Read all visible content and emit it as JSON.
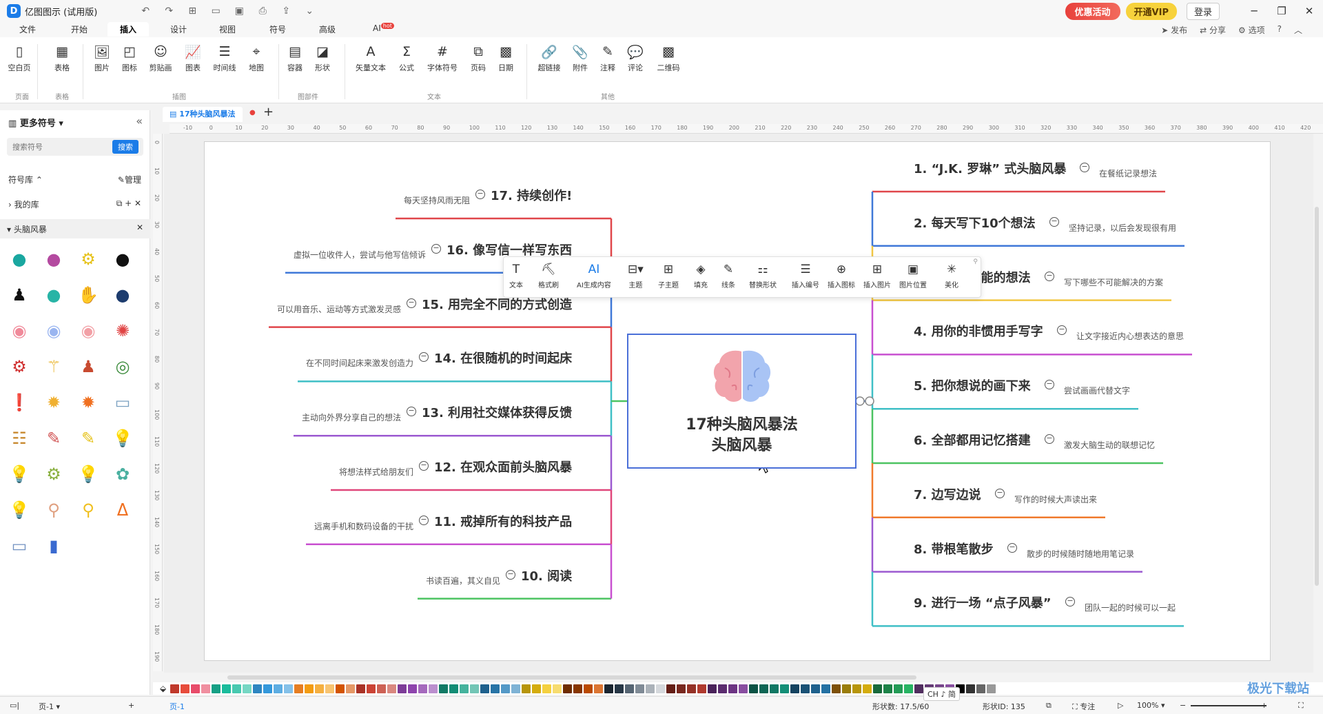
{
  "app": {
    "title": "亿图图示 (试用版)",
    "logo": "D"
  },
  "titlebar": {
    "promo": "优惠活动",
    "vip": "开通VIP",
    "login": "登录"
  },
  "menu": {
    "tabs": [
      "文件",
      "开始",
      "插入",
      "设计",
      "视图",
      "符号",
      "高级",
      "AI"
    ],
    "active": "插入",
    "ai_badge": "hot",
    "right": [
      "发布",
      "分享",
      "选项"
    ]
  },
  "ribbon": {
    "buttons": [
      "空白页",
      "表格",
      "图片",
      "图标",
      "剪贴画",
      "图表",
      "时间线",
      "地图",
      "容器",
      "形状",
      "矢量文本",
      "公式",
      "字体符号",
      "页码",
      "日期",
      "超链接",
      "附件",
      "注释",
      "评论",
      "二维码"
    ],
    "groups": [
      "页面",
      "表格",
      "插图",
      "图部件",
      "文本",
      "其他"
    ]
  },
  "leftpanel": {
    "title": "更多符号",
    "search_placeholder": "搜索符号",
    "search_button": "搜索",
    "library_label": "符号库",
    "manage": "管理",
    "my_library": "我的库",
    "category": "头脑风暴"
  },
  "doc": {
    "tab_title": "17种头脑风暴法",
    "new_tab": "+"
  },
  "ruler_h": [
    "-10",
    "0",
    "10",
    "20",
    "30",
    "40",
    "50",
    "60",
    "70",
    "80",
    "90",
    "100",
    "110",
    "120",
    "130",
    "140",
    "150",
    "160",
    "170",
    "180",
    "190",
    "200",
    "210",
    "220",
    "230",
    "240",
    "250",
    "260",
    "270",
    "280",
    "290",
    "300",
    "310",
    "320",
    "330",
    "340",
    "350",
    "360",
    "370",
    "380",
    "390",
    "400",
    "410",
    "420"
  ],
  "ruler_v": [
    "0",
    "10",
    "20",
    "30",
    "40",
    "50",
    "60",
    "70",
    "80",
    "90",
    "100",
    "110",
    "120",
    "130",
    "140",
    "150",
    "160",
    "170",
    "180",
    "190"
  ],
  "mindmap": {
    "center": {
      "line1": "17种头脑风暴法",
      "line2": "头脑风暴"
    },
    "right": [
      {
        "title": "1. “J.K. 罗琳” 式头脑风暴",
        "note": "在餐纸记录想法",
        "color": "#e0464a"
      },
      {
        "title": "2. 每天写下10个想法",
        "note": "坚持记录，以后会发现很有用",
        "color": "#3f78d8"
      },
      {
        "title": "3. 每个不可能的想法",
        "note": "写下哪些不可能解决的方案",
        "color": "#f2c744"
      },
      {
        "title": "4. 用你的非惯用手写字",
        "note": "让文字接近内心想表达的意思",
        "color": "#c84fd0"
      },
      {
        "title": "5. 把你想说的画下来",
        "note": "尝试画画代替文字",
        "color": "#3fbfc6"
      },
      {
        "title": "6. 全部都用记忆搭建",
        "note": "激发大脑生动的联想记忆",
        "color": "#4cc361"
      },
      {
        "title": "7. 边写边说",
        "note": "写作的时候大声读出来",
        "color": "#f07a2c"
      },
      {
        "title": "8. 带根笔散步",
        "note": "散步的时候随时随地用笔记录",
        "color": "#9b59d0"
      },
      {
        "title": "9. 进行一场 “点子风暴”",
        "note": "团队一起的时候可以一起",
        "color": "#3fbfc6"
      }
    ],
    "left": [
      {
        "title": "17. 持续创作!",
        "note": "每天坚持风雨无阻",
        "color": "#e0464a"
      },
      {
        "title": "16. 像写信一样写东西",
        "note": "虚拟一位收件人，尝试与他写信倾诉",
        "color": "#3f78d8"
      },
      {
        "title": "15. 用完全不同的方式创造",
        "note": "可以用音乐、运动等方式激发灵感",
        "color": "#e0464a"
      },
      {
        "title": "14. 在很随机的时间起床",
        "note": "在不同时间起床来激发创造力",
        "color": "#3fbfc6"
      },
      {
        "title": "13. 利用社交媒体获得反馈",
        "note": "主动向外界分享自己的想法",
        "color": "#9b59d0"
      },
      {
        "title": "12. 在观众面前头脑风暴",
        "note": "将想法样式给朋友们",
        "color": "#e0467a"
      },
      {
        "title": "11. 戒掉所有的科技产品",
        "note": "远离手机和数码设备的干扰",
        "color": "#c84fd0"
      },
      {
        "title": "10. 阅读",
        "note": "书读百遍，其义自见",
        "color": "#4cc361"
      }
    ]
  },
  "floatbar": [
    "文本",
    "格式刷",
    "AI生成内容",
    "主题",
    "子主题",
    "填充",
    "线条",
    "替换形状",
    "插入编号",
    "插入图标",
    "插入图片",
    "图片位置",
    "美化"
  ],
  "palette": [
    "#c0392b",
    "#e74c3c",
    "#e84c6a",
    "#f08fa0",
    "#16a085",
    "#1abc9c",
    "#48c9b0",
    "#76d7c4",
    "#2e86c1",
    "#3498db",
    "#5dade2",
    "#85c1e9",
    "#e67e22",
    "#f39c12",
    "#f5b041",
    "#f8c471",
    "#d35400",
    "#e59866",
    "#a93226",
    "#cb4335",
    "#cd6155",
    "#d98880",
    "#7d3c98",
    "#8e44ad",
    "#a569bd",
    "#bb8fce",
    "#117a65",
    "#138d75",
    "#45b39d",
    "#73c6b6",
    "#1f618d",
    "#2874a6",
    "#5499c7",
    "#7fb3d5",
    "#b7950b",
    "#d4ac0d",
    "#f4d03f",
    "#f7dc6f",
    "#6e2c00",
    "#873600",
    "#ba4a00",
    "#dc7633",
    "#1b2631",
    "#273746",
    "#566573",
    "#808b96",
    "#abb2b9",
    "#d5d8dc",
    "#641e16",
    "#78281f",
    "#943126",
    "#b03a2e",
    "#4a235a",
    "#5b2c6f",
    "#6c3483",
    "#884ea0",
    "#0b5345",
    "#0e6655",
    "#117864",
    "#148f77",
    "#154360",
    "#1a5276",
    "#1f618d",
    "#2471a3",
    "#7e5109",
    "#9a7d0a",
    "#b7950b",
    "#d4ac0d",
    "#186a3b",
    "#1d8348",
    "#239b56",
    "#28b463",
    "#512e5f",
    "#633974",
    "#76448a",
    "#884ea0",
    "#000000",
    "#333333",
    "#666666",
    "#999999"
  ],
  "status": {
    "page_label": "页-1",
    "page_tab": "页-1",
    "shape_count": "形状数: 17.5/60",
    "shape_id": "形状ID: 135",
    "focus": "专注",
    "zoom": "100%",
    "ime": "CH ♪ 简"
  },
  "watermark": "极光下载站"
}
